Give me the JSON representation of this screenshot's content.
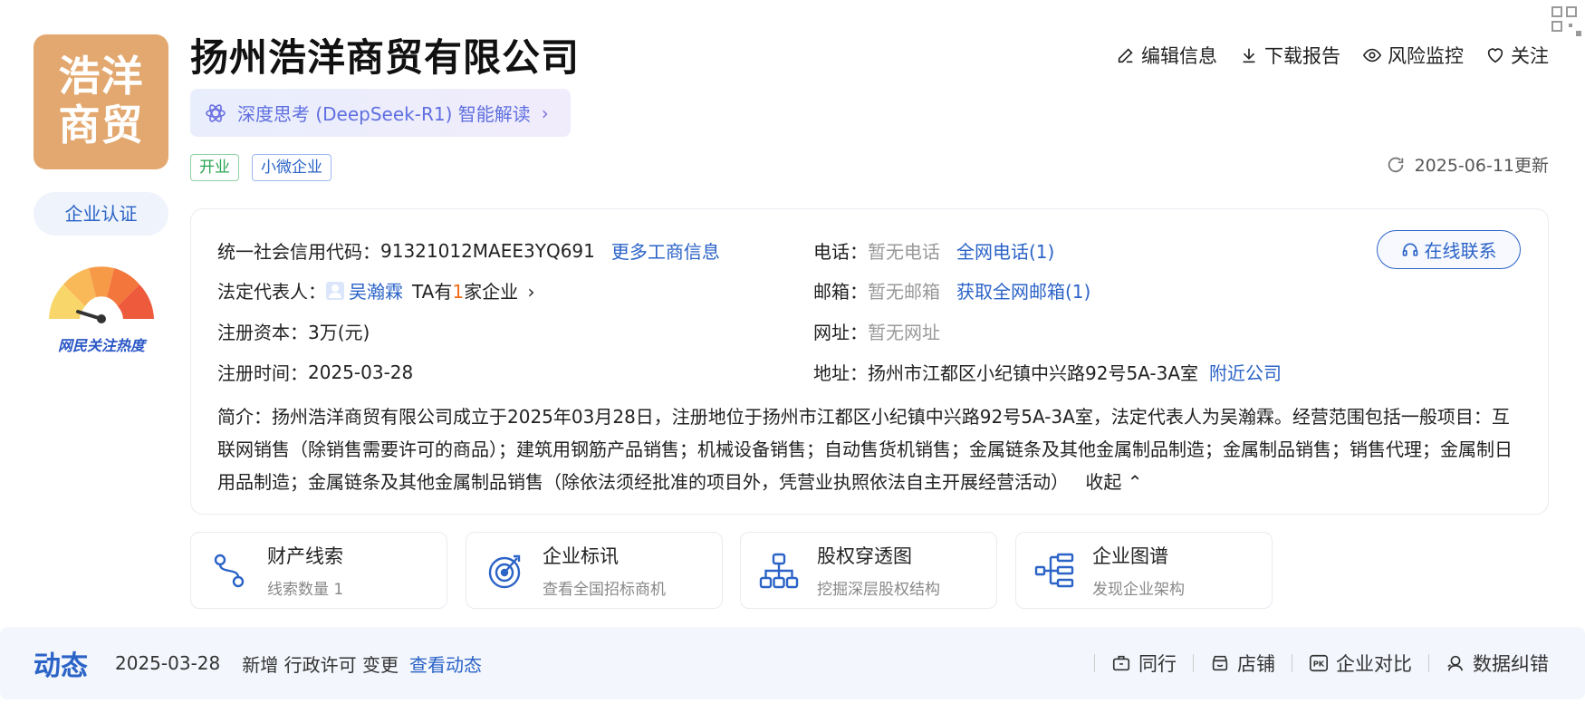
{
  "company": {
    "logo_text_line1": "浩洋",
    "logo_text_line2": "商贸",
    "name": "扬州浩洋商贸有限公司",
    "certification": "企业认证",
    "heat_label": "网民关注热度",
    "ai_prompt": "深度思考 (DeepSeek-R1) 智能解读",
    "tags": [
      "开业",
      "小微企业"
    ]
  },
  "actions": {
    "edit": "编辑信息",
    "download": "下载报告",
    "monitor": "风险监控",
    "follow": "关注"
  },
  "update_text": "2025-06-11更新",
  "info": {
    "credit_code_label": "统一社会信用代码：",
    "credit_code": "91321012MAEE3YQ691",
    "more_info": "更多工商信息",
    "legal_rep_label": "法定代表人：",
    "legal_rep": "吴瀚霖",
    "ta_prefix": "TA有",
    "ta_count": "1",
    "ta_suffix": "家企业",
    "capital_label": "注册资本：",
    "capital": "3万(元)",
    "reg_date_label": "注册时间：",
    "reg_date": "2025-03-28",
    "phone_label": "电话：",
    "phone": "暂无电话",
    "phone_link": "全网电话(1)",
    "email_label": "邮箱：",
    "email": "暂无邮箱",
    "email_link": "获取全网邮箱(1)",
    "website_label": "网址：",
    "website": "暂无网址",
    "address_label": "地址：",
    "address": "扬州市江都区小纪镇中兴路92号5A-3A室",
    "nearby": "附近公司",
    "contact_online": "在线联系",
    "intro_label": "简介：",
    "intro": "扬州浩洋商贸有限公司成立于2025年03月28日，注册地位于扬州市江都区小纪镇中兴路92号5A-3A室，法定代表人为吴瀚霖。经营范围包括一般项目：互联网销售（除销售需要许可的商品）；建筑用钢筋产品销售；机械设备销售；自动售货机销售；金属链条及其他金属制品制造；金属制品销售；销售代理；金属制日用品制造；金属链条及其他金属制品销售（除依法须经批准的项目外，凭营业执照依法自主开展经营活动）",
    "collapse": "收起"
  },
  "features": [
    {
      "title": "财产线索",
      "sub": "线索数量 1"
    },
    {
      "title": "企业标讯",
      "sub": "查看全国招标商机"
    },
    {
      "title": "股权穿透图",
      "sub": "挖掘深层股权结构"
    },
    {
      "title": "企业图谱",
      "sub": "发现企业架构"
    }
  ],
  "dynamics": {
    "label": "动态",
    "date": "2025-03-28",
    "news": "新增 行政许可 变更",
    "view": "查看动态"
  },
  "bottom_actions": {
    "peer": "同行",
    "shop": "店铺",
    "compare": "企业对比",
    "correct": "数据纠错"
  },
  "colors": {
    "brand_blue": "#2b63c7",
    "logo_bg": "#e3a86f",
    "tag_green": "#2aa553",
    "highlight_orange": "#f36b16"
  }
}
